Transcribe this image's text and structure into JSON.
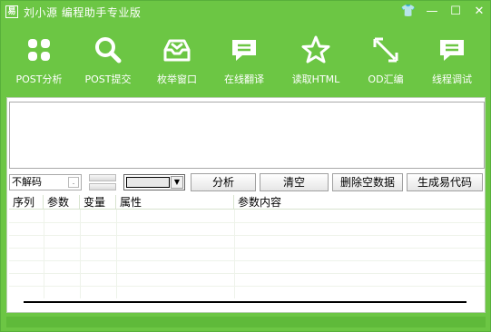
{
  "window": {
    "title": "刘小源  编程助手专业版",
    "icon_glyph": "易",
    "controls": {
      "skin": "👕",
      "minimize": "—",
      "maximize": "☐",
      "close": "✕"
    }
  },
  "toolbar": {
    "items": [
      {
        "label": "POST分析",
        "icon": "grid-icon"
      },
      {
        "label": "POST提交",
        "icon": "search-icon"
      },
      {
        "label": "枚举窗口",
        "icon": "inbox-icon"
      },
      {
        "label": "在线翻译",
        "icon": "chat-icon"
      },
      {
        "label": "读取HTML",
        "icon": "star-icon"
      },
      {
        "label": "OD汇编",
        "icon": "expand-icon"
      },
      {
        "label": "线程调试",
        "icon": "chat-icon"
      }
    ]
  },
  "controls": {
    "decode_value": "不解码",
    "decode_dot": ".",
    "analyze_label": "分析",
    "clear_label": "清空",
    "delete_empty_label": "删除空数据",
    "gen_code_label": "生成易代码"
  },
  "table": {
    "columns": [
      "序列",
      "参数",
      "变量",
      "属性",
      "参数内容"
    ],
    "rows": []
  },
  "colors": {
    "frame": "#6cc644",
    "panel": "#ffffff"
  }
}
